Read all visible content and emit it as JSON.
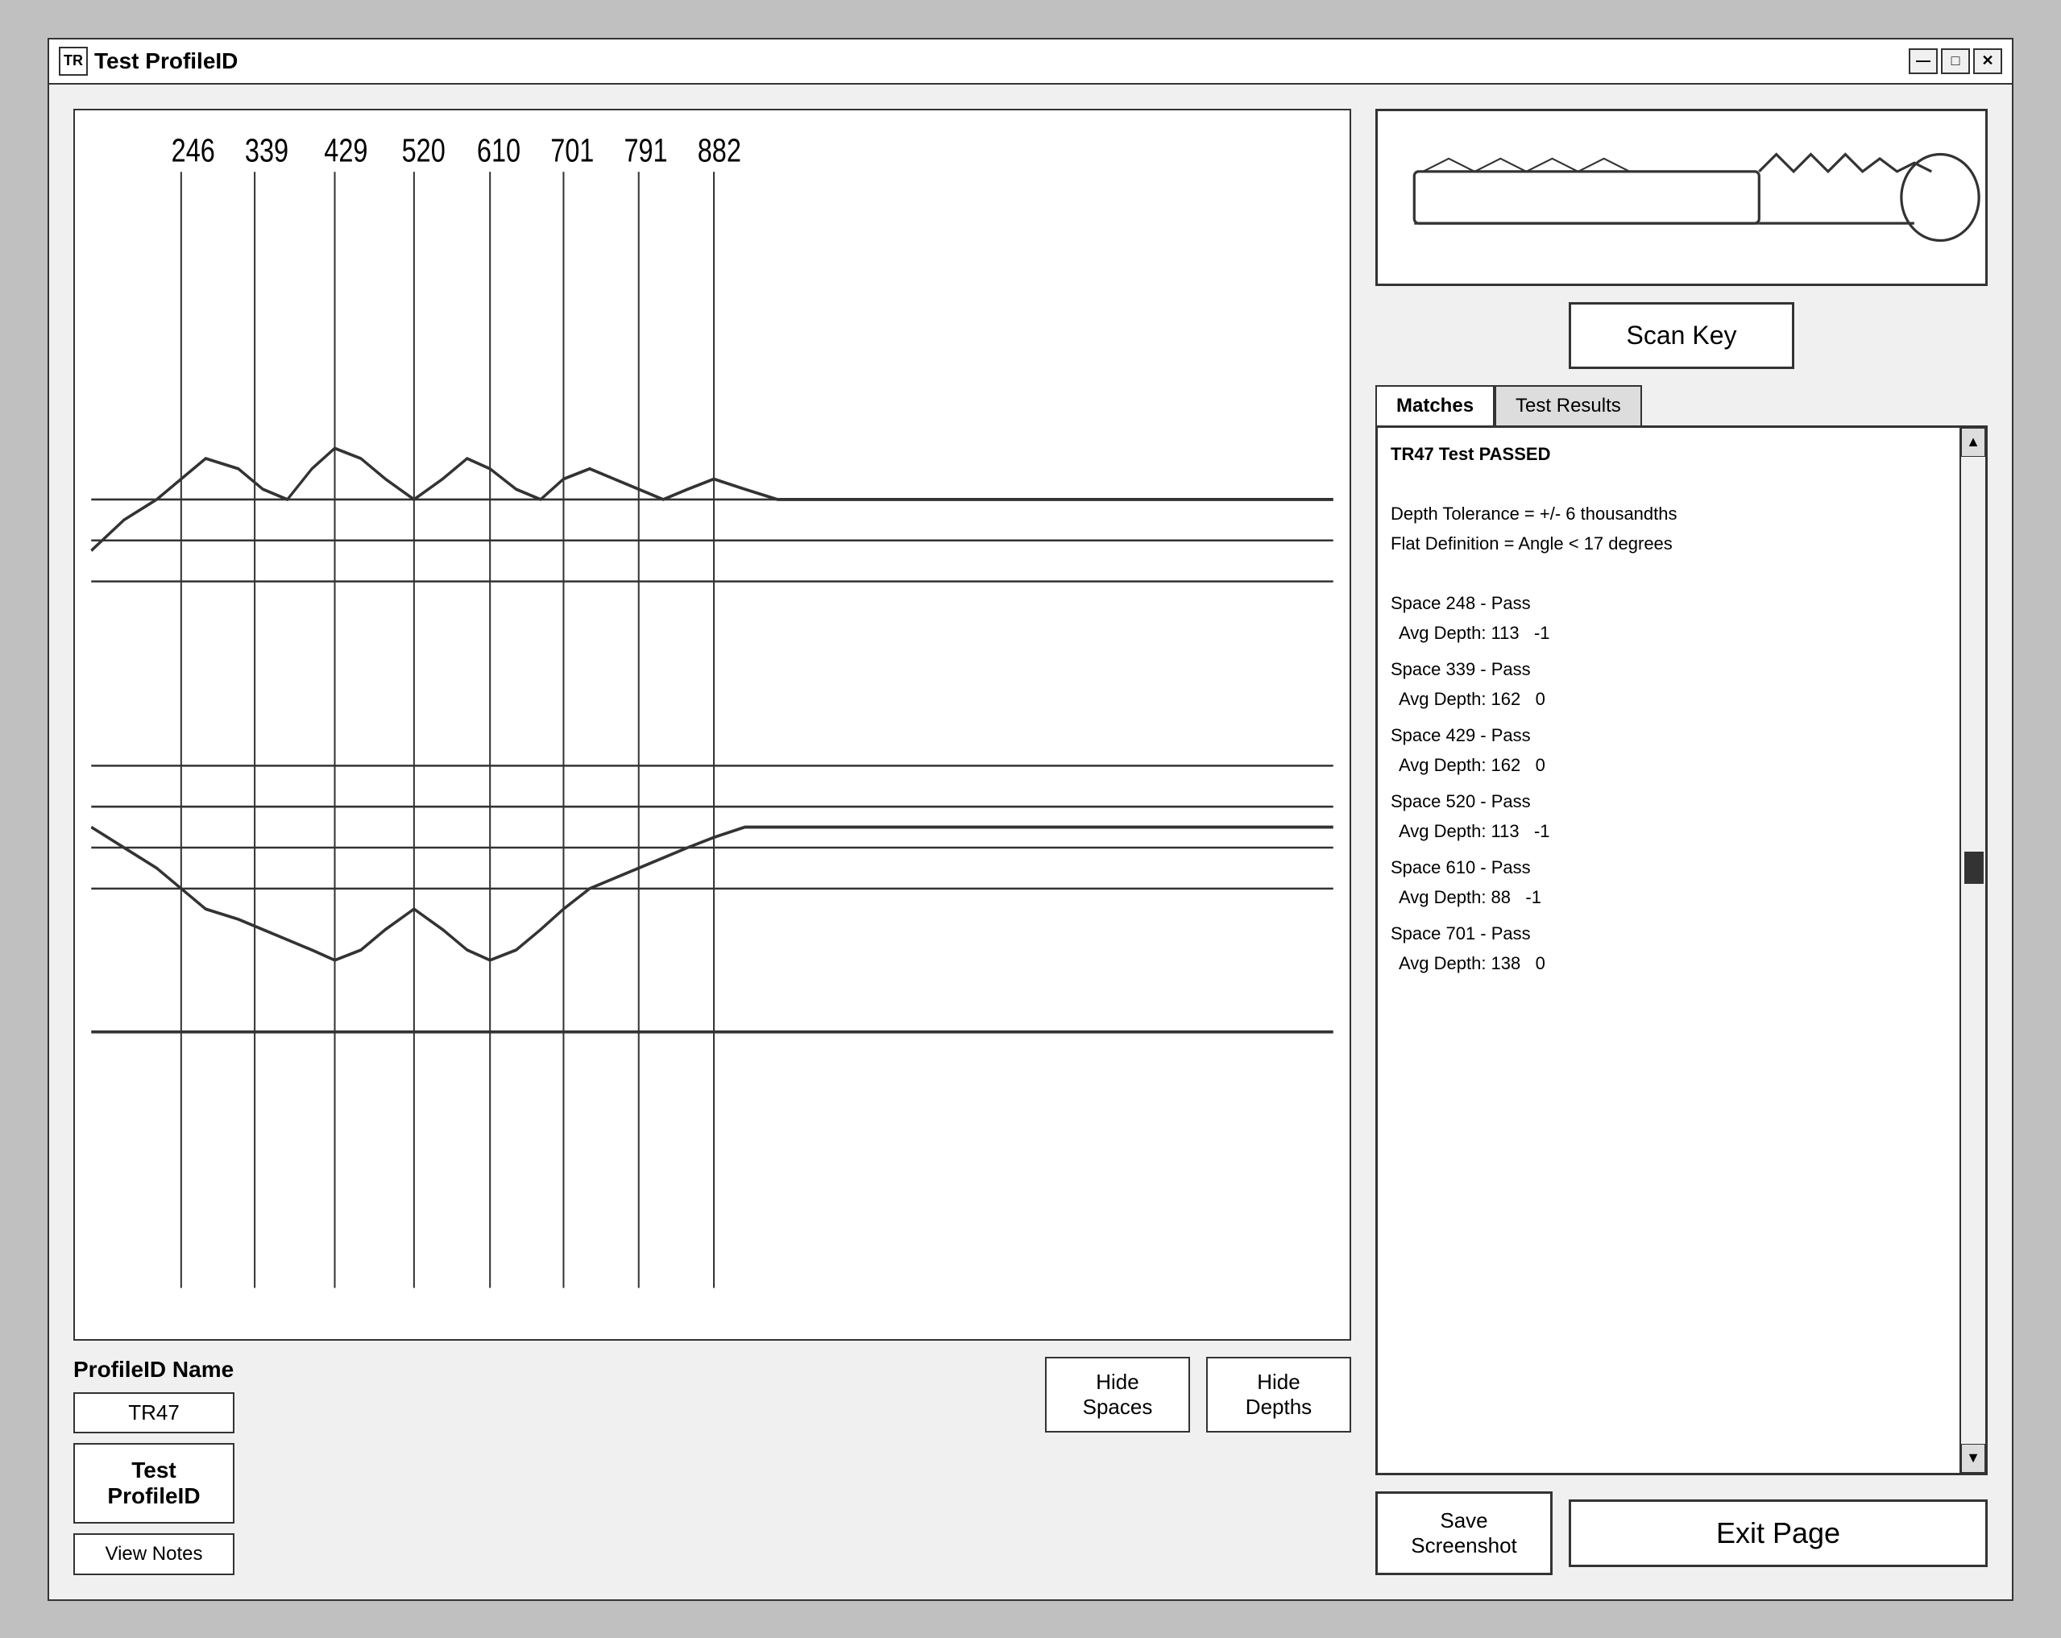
{
  "window": {
    "title": "Test ProfileID",
    "icon": "TR"
  },
  "titleBar": {
    "minimize": "—",
    "maximize": "□",
    "close": "✕"
  },
  "chart": {
    "labels": [
      "246",
      "339",
      "429",
      "520",
      "610",
      "701",
      "791",
      "882"
    ],
    "labelPositions": [
      8,
      18,
      28,
      38,
      48,
      58,
      68,
      78
    ]
  },
  "profileSection": {
    "nameLabel": "ProfileID Name",
    "nameValue": "TR47",
    "testButtonLine1": "Test",
    "testButtonLine2": "ProfileID",
    "viewNotesLabel": "View Notes"
  },
  "hideButtons": {
    "hideSpacesLine1": "Hide",
    "hideSpacesLine2": "Spaces",
    "hideDepthsLine1": "Hide",
    "hideDepthsLine2": "Depths"
  },
  "rightPanel": {
    "scanKeyLabel": "Scan Key",
    "tabs": [
      {
        "label": "Matches",
        "active": true
      },
      {
        "label": "Test Results",
        "active": false
      }
    ],
    "results": {
      "title": "TR47 Test PASSED",
      "depthTolerance": "Depth Tolerance = +/- 6 thousandths",
      "flatDefinition": "Flat Definition = Angle < 17 degrees",
      "spaces": [
        {
          "label": "Space 248 - Pass",
          "depth": "Avg Depth: 113",
          "val": "-1"
        },
        {
          "label": "Space 339 - Pass",
          "depth": "Avg Depth: 162",
          "val": "0"
        },
        {
          "label": "Space 429 - Pass",
          "depth": "Avg Depth: 162",
          "val": "0"
        },
        {
          "label": "Space 520 - Pass",
          "depth": "Avg Depth: 113",
          "val": "-1"
        },
        {
          "label": "Space 610 - Pass",
          "depth": "Avg Depth: 88",
          "val": "-1"
        },
        {
          "label": "Space 701 - Pass",
          "depth": "Avg Depth: 138",
          "val": "0"
        }
      ]
    }
  },
  "bottomButtons": {
    "saveScreenshot": "Save\nScreenshot",
    "exitPage": "Exit Page"
  }
}
